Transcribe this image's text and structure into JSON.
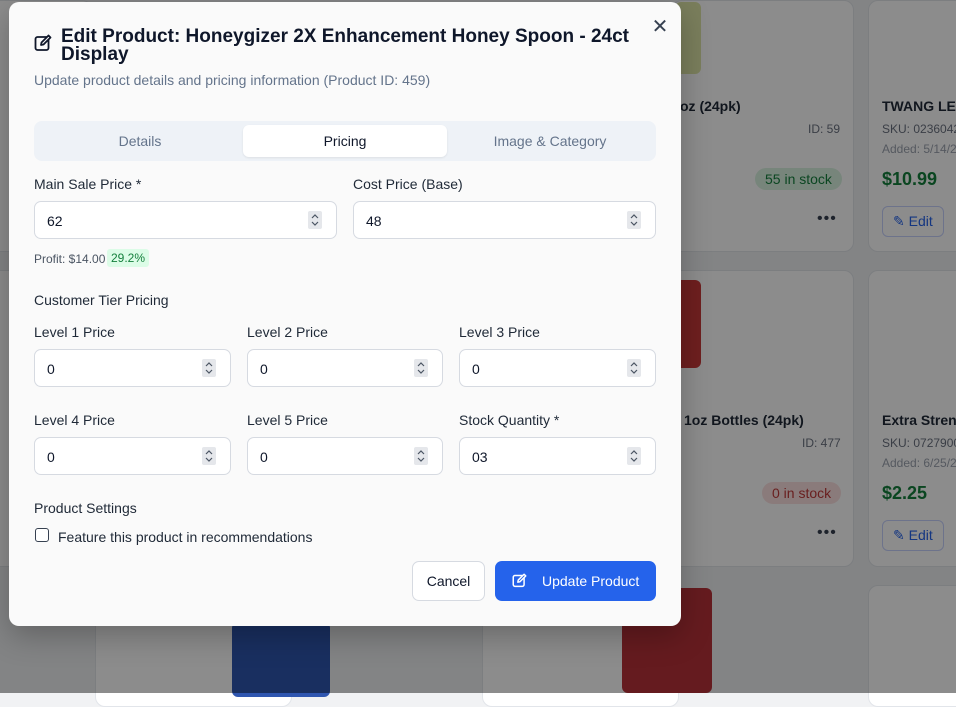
{
  "background": {
    "cards": [
      {
        "name": "oz (24pk)",
        "id": "ID: 59",
        "stock": "55 in stock"
      },
      {
        "name": "TWANG LE",
        "sku": "SKU: 0236042",
        "added": "Added: 5/14/2",
        "price": "$10.99",
        "edit": "Edit"
      },
      {
        "name": "1oz Bottles (24pk)",
        "id": "ID: 477",
        "stock": "0 in stock"
      },
      {
        "name": "Extra Stren",
        "sku": "SKU: 0727900",
        "added": "Added: 6/25/2",
        "price": "$2.25",
        "edit": "Edit"
      }
    ]
  },
  "modal": {
    "title": "Edit Product: Honeygizer 2X Enhancement Honey Spoon - 24ct Display",
    "subtitle": "Update product details and pricing information (Product ID: 459)",
    "close_icon": "close-icon",
    "tabs": [
      {
        "label": "Details",
        "active": false
      },
      {
        "label": "Pricing",
        "active": true
      },
      {
        "label": "Image & Category",
        "active": false
      }
    ],
    "main_sale_price": {
      "label": "Main Sale Price *",
      "value": "62"
    },
    "cost_price": {
      "label": "Cost Price (Base)",
      "value": "48"
    },
    "profit": {
      "text": "Profit: $14.00",
      "percent": "29.2%"
    },
    "tier_heading": "Customer Tier Pricing",
    "levels": [
      {
        "label": "Level 1 Price",
        "value": "0"
      },
      {
        "label": "Level 2 Price",
        "value": "0"
      },
      {
        "label": "Level 3 Price",
        "value": "0"
      },
      {
        "label": "Level 4 Price",
        "value": "0"
      },
      {
        "label": "Level 5 Price",
        "value": "0"
      }
    ],
    "stock_quantity": {
      "label": "Stock Quantity *",
      "value": "03"
    },
    "settings_heading": "Product Settings",
    "feature_checkbox": {
      "label": "Feature this product in recommendations",
      "checked": false
    },
    "cancel_label": "Cancel",
    "update_label": "Update Product",
    "accent_color": "#2563eb"
  }
}
